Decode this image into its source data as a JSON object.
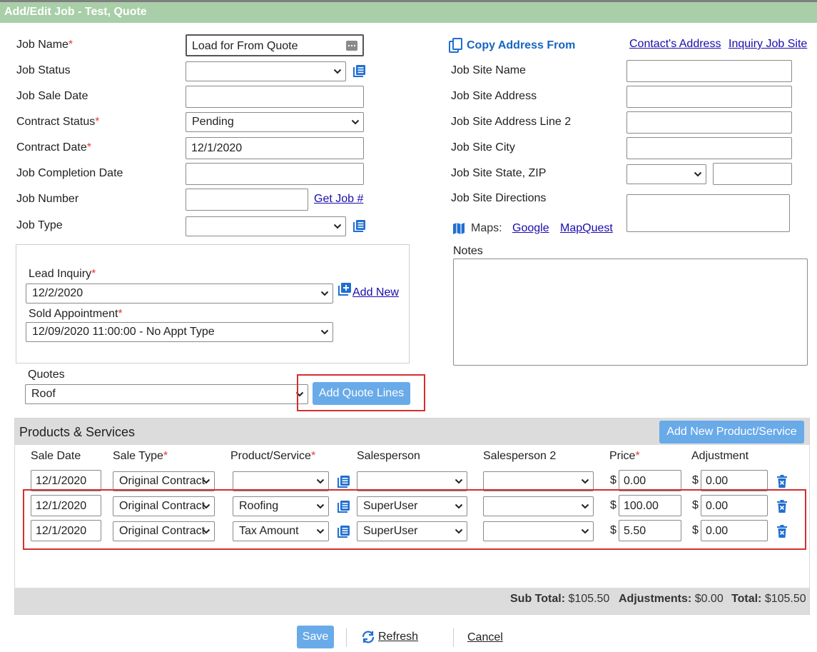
{
  "window": {
    "title": "Add/Edit Job - Test, Quote"
  },
  "job": {
    "name_label": "Job Name",
    "name_value": "Load for From Quote",
    "status_label": "Job Status",
    "sale_date_label": "Job Sale Date",
    "contract_status_label": "Contract Status",
    "contract_status_value": "Pending",
    "contract_date_label": "Contract Date",
    "contract_date_value": "12/1/2020",
    "completion_date_label": "Job Completion Date",
    "number_label": "Job Number",
    "get_job_link": "Get Job #",
    "type_label": "Job Type"
  },
  "lead": {
    "inquiry_label": "Lead Inquiry",
    "inquiry_value": "12/2/2020",
    "add_new_link": "Add New",
    "appointment_label": "Sold Appointment",
    "appointment_value": "12/09/2020 11:00:00 - No Appt Type"
  },
  "quotes": {
    "label": "Quotes",
    "value": "Roof",
    "add_lines_button": "Add Quote Lines"
  },
  "site": {
    "copy_from_label": "Copy Address From",
    "contacts_address_link": "Contact's Address",
    "inquiry_job_site_link": "Inquiry Job Site",
    "name_label": "Job Site Name",
    "address_label": "Job Site Address",
    "address2_label": "Job Site Address Line 2",
    "city_label": "Job Site City",
    "state_zip_label": "Job Site State, ZIP",
    "directions_label": "Job Site Directions",
    "maps_label": "Maps:",
    "google_link": "Google",
    "mapquest_link": "MapQuest",
    "notes_label": "Notes"
  },
  "products": {
    "section_title": "Products & Services",
    "add_button": "Add New Product/Service",
    "columns": [
      "Sale Date",
      "Sale Type",
      "Product/Service",
      "Salesperson",
      "Salesperson 2",
      "Price",
      "Adjustment"
    ],
    "currency": "$",
    "rows": [
      {
        "sale_date": "12/1/2020",
        "sale_type": "Original Contract",
        "product": "",
        "salesperson": "",
        "salesperson2": "",
        "price": "0.00",
        "adjustment": "0.00"
      },
      {
        "sale_date": "12/1/2020",
        "sale_type": "Original Contract",
        "product": "Roofing",
        "salesperson": "SuperUser",
        "salesperson2": "",
        "price": "100.00",
        "adjustment": "0.00"
      },
      {
        "sale_date": "12/1/2020",
        "sale_type": "Original Contract",
        "product": "Tax Amount",
        "salesperson": "SuperUser",
        "salesperson2": "",
        "price": "5.50",
        "adjustment": "0.00"
      }
    ],
    "totals": {
      "subtotal_label": "Sub Total:",
      "subtotal_value": "$105.50",
      "adjustments_label": "Adjustments:",
      "adjustments_value": "$0.00",
      "total_label": "Total:",
      "total_value": "$105.50"
    }
  },
  "footer": {
    "save": "Save",
    "refresh": "Refresh",
    "cancel": "Cancel"
  },
  "colors": {
    "title_bar": "#a8cfa8",
    "accent_button": "#69aae9",
    "highlight_outline": "#d32f2f",
    "link": "#1a0dab",
    "required": "#e53935"
  }
}
